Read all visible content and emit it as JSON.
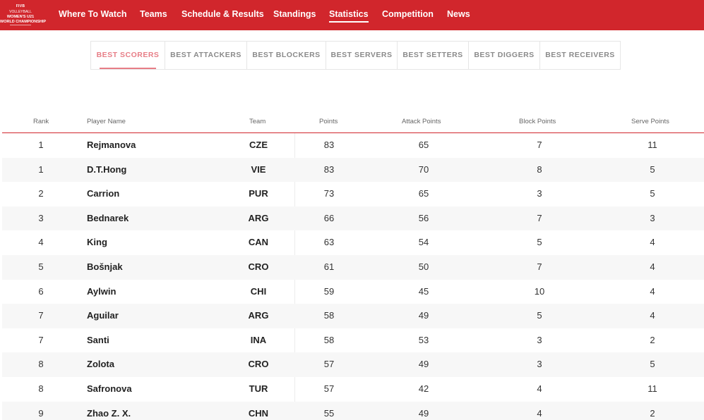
{
  "header": {
    "logo": {
      "line1": "FIVB",
      "line2": "VOLLEYBALL",
      "line3": "WOMEN'S U21",
      "line4": "WORLD CHAMPIONSHIP"
    },
    "nav": [
      {
        "label": "Where To Watch",
        "active": false
      },
      {
        "label": "Teams",
        "active": false
      },
      {
        "label": "Schedule & Results",
        "active": false
      },
      {
        "label": "Standings",
        "active": false
      },
      {
        "label": "Statistics",
        "active": true
      },
      {
        "label": "Competition",
        "active": false
      },
      {
        "label": "News",
        "active": false
      }
    ]
  },
  "tabs": [
    {
      "label": "BEST SCORERS",
      "active": true
    },
    {
      "label": "BEST ATTACKERS",
      "active": false
    },
    {
      "label": "BEST BLOCKERS",
      "active": false
    },
    {
      "label": "BEST SERVERS",
      "active": false
    },
    {
      "label": "BEST SETTERS",
      "active": false
    },
    {
      "label": "BEST DIGGERS",
      "active": false
    },
    {
      "label": "BEST RECEIVERS",
      "active": false
    }
  ],
  "table": {
    "columns": [
      "Rank",
      "Player Name",
      "Team",
      "Points",
      "Attack Points",
      "Block Points",
      "Serve Points"
    ],
    "rows": [
      [
        "1",
        "Rejmanova",
        "CZE",
        "83",
        "65",
        "7",
        "11"
      ],
      [
        "1",
        "D.T.Hong",
        "VIE",
        "83",
        "70",
        "8",
        "5"
      ],
      [
        "2",
        "Carrion",
        "PUR",
        "73",
        "65",
        "3",
        "5"
      ],
      [
        "3",
        "Bednarek",
        "ARG",
        "66",
        "56",
        "7",
        "3"
      ],
      [
        "4",
        "King",
        "CAN",
        "63",
        "54",
        "5",
        "4"
      ],
      [
        "5",
        "Bošnjak",
        "CRO",
        "61",
        "50",
        "7",
        "4"
      ],
      [
        "6",
        "Aylwin",
        "CHI",
        "59",
        "45",
        "10",
        "4"
      ],
      [
        "7",
        "Aguilar",
        "ARG",
        "58",
        "49",
        "5",
        "4"
      ],
      [
        "7",
        "Santi",
        "INA",
        "58",
        "53",
        "3",
        "2"
      ],
      [
        "8",
        "Zolota",
        "CRO",
        "57",
        "49",
        "3",
        "5"
      ],
      [
        "8",
        "Safronova",
        "TUR",
        "57",
        "42",
        "4",
        "11"
      ],
      [
        "9",
        "Zhao Z. X.",
        "CHN",
        "55",
        "49",
        "4",
        "2"
      ]
    ]
  },
  "colors": {
    "brand_red": "#d1262c",
    "active_tab": "#e77d86"
  }
}
